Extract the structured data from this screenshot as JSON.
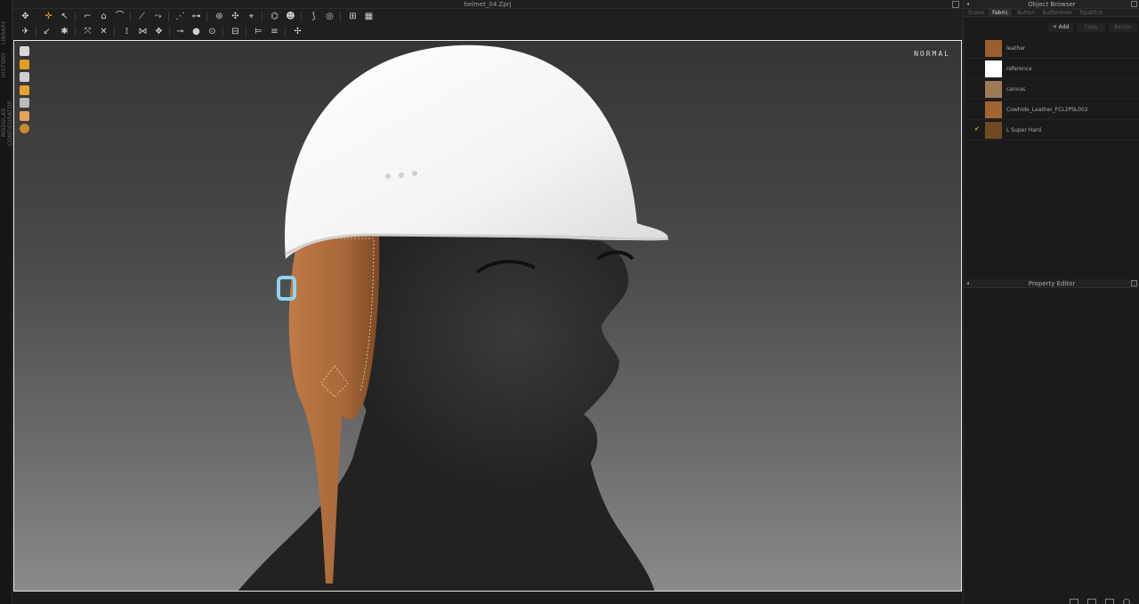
{
  "window": {
    "title": "helmet_04.Zprj"
  },
  "left_strip": {
    "tabs": [
      "LIBRARY",
      "HISTORY",
      "MODULAR CONFIGURATOR"
    ]
  },
  "viewport": {
    "mode_label": "NORMAL"
  },
  "object_browser": {
    "title": "Object Browser",
    "tabs": [
      {
        "label": "Scene",
        "active": false
      },
      {
        "label": "Fabric",
        "active": true
      },
      {
        "label": "Button",
        "active": false
      },
      {
        "label": "Buttonhole",
        "active": false
      },
      {
        "label": "Topstitch",
        "active": false
      }
    ],
    "actions": {
      "add": "+ Add",
      "copy": "Copy",
      "assign": "Assign"
    },
    "fabrics": [
      {
        "name": "leather",
        "swatch": "#9a5f2c",
        "checked": false
      },
      {
        "name": "reference",
        "swatch": "#ffffff",
        "checked": false
      },
      {
        "name": "canvas",
        "swatch": "#9d7a58",
        "checked": false
      },
      {
        "name": "Cowhide_Leather_FCL2PSL002",
        "swatch": "#a06530",
        "checked": true,
        "check_mark": ""
      },
      {
        "name": "L Super Hard",
        "swatch": "#6e4a22",
        "checked": true,
        "check_mark": "✔"
      }
    ]
  },
  "property_editor": {
    "title": "Property Editor"
  },
  "colors": {
    "accent": "#e8b000",
    "helmet": "#f2f2f2",
    "leather": "#a8683a",
    "mannequin": "#2a2a2a"
  }
}
